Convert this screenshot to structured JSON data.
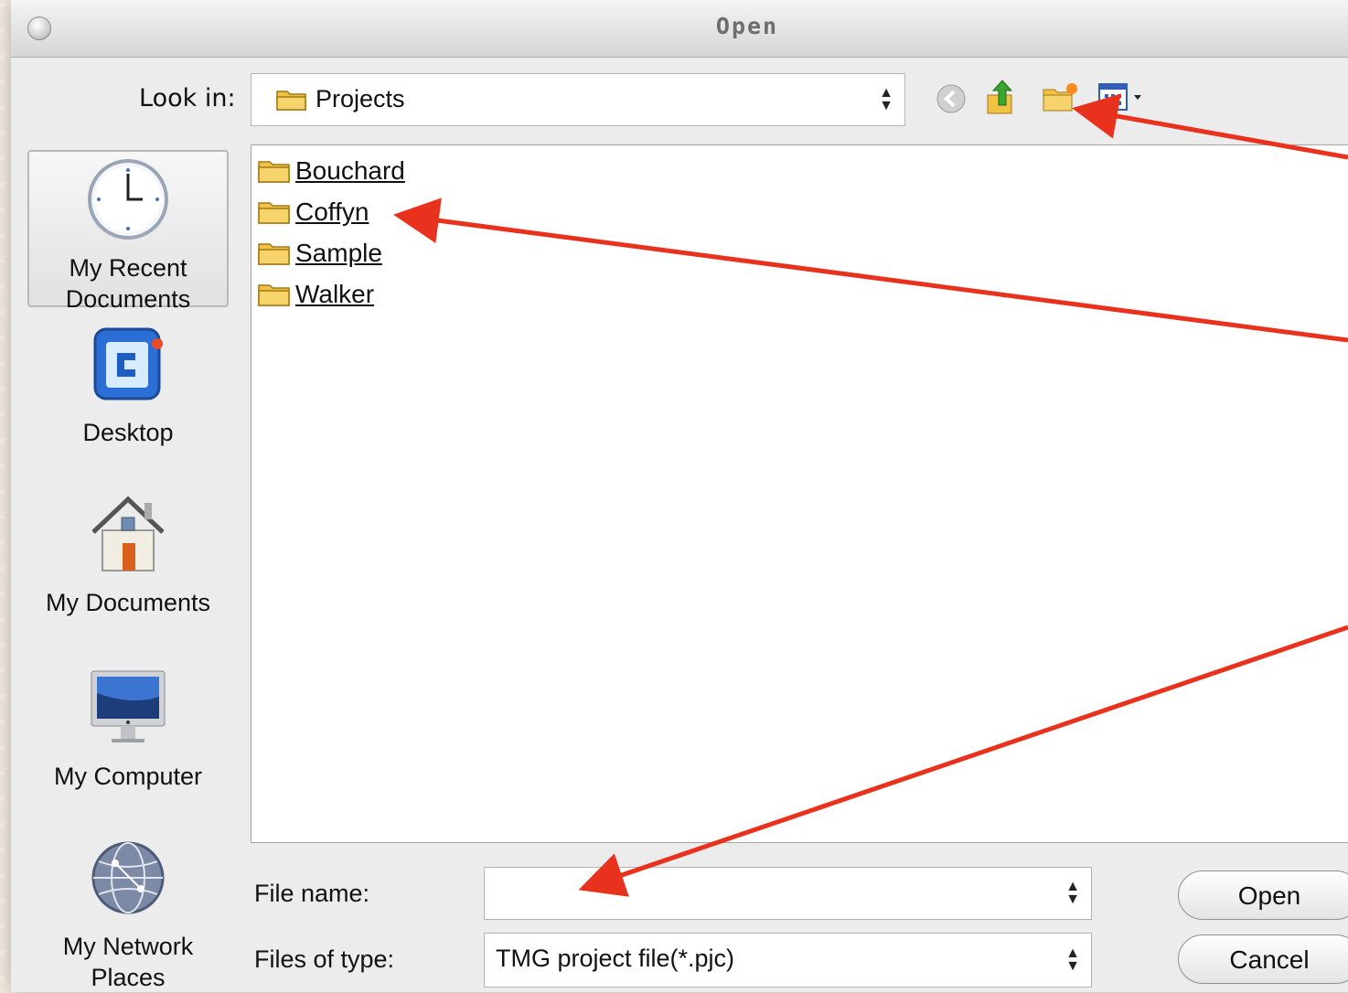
{
  "window": {
    "title": "Open"
  },
  "lookin": {
    "label": "Look in:",
    "value": "Projects"
  },
  "toolbar": {
    "icons": [
      "back-icon",
      "up-folder-icon",
      "new-folder-icon",
      "view-menu-icon"
    ]
  },
  "places": [
    {
      "label": "My Recent Documents",
      "icon": "clock-icon"
    },
    {
      "label": "Desktop",
      "icon": "desktop-icon"
    },
    {
      "label": "My Documents",
      "icon": "house-icon"
    },
    {
      "label": "My Computer",
      "icon": "computer-icon"
    },
    {
      "label": "My Network Places",
      "icon": "globe-icon"
    }
  ],
  "files": [
    {
      "name": "Bouchard"
    },
    {
      "name": "Coffyn"
    },
    {
      "name": "Sample"
    },
    {
      "name": "Walker"
    }
  ],
  "filename": {
    "label": "File name:",
    "value": ""
  },
  "filetype": {
    "label": "Files of type:",
    "value": "TMG project file(*.pjc)"
  },
  "buttons": {
    "open": "Open",
    "cancel": "Cancel"
  },
  "colors": {
    "annotation_arrow": "#e8321e",
    "folder": "#f2c244"
  }
}
